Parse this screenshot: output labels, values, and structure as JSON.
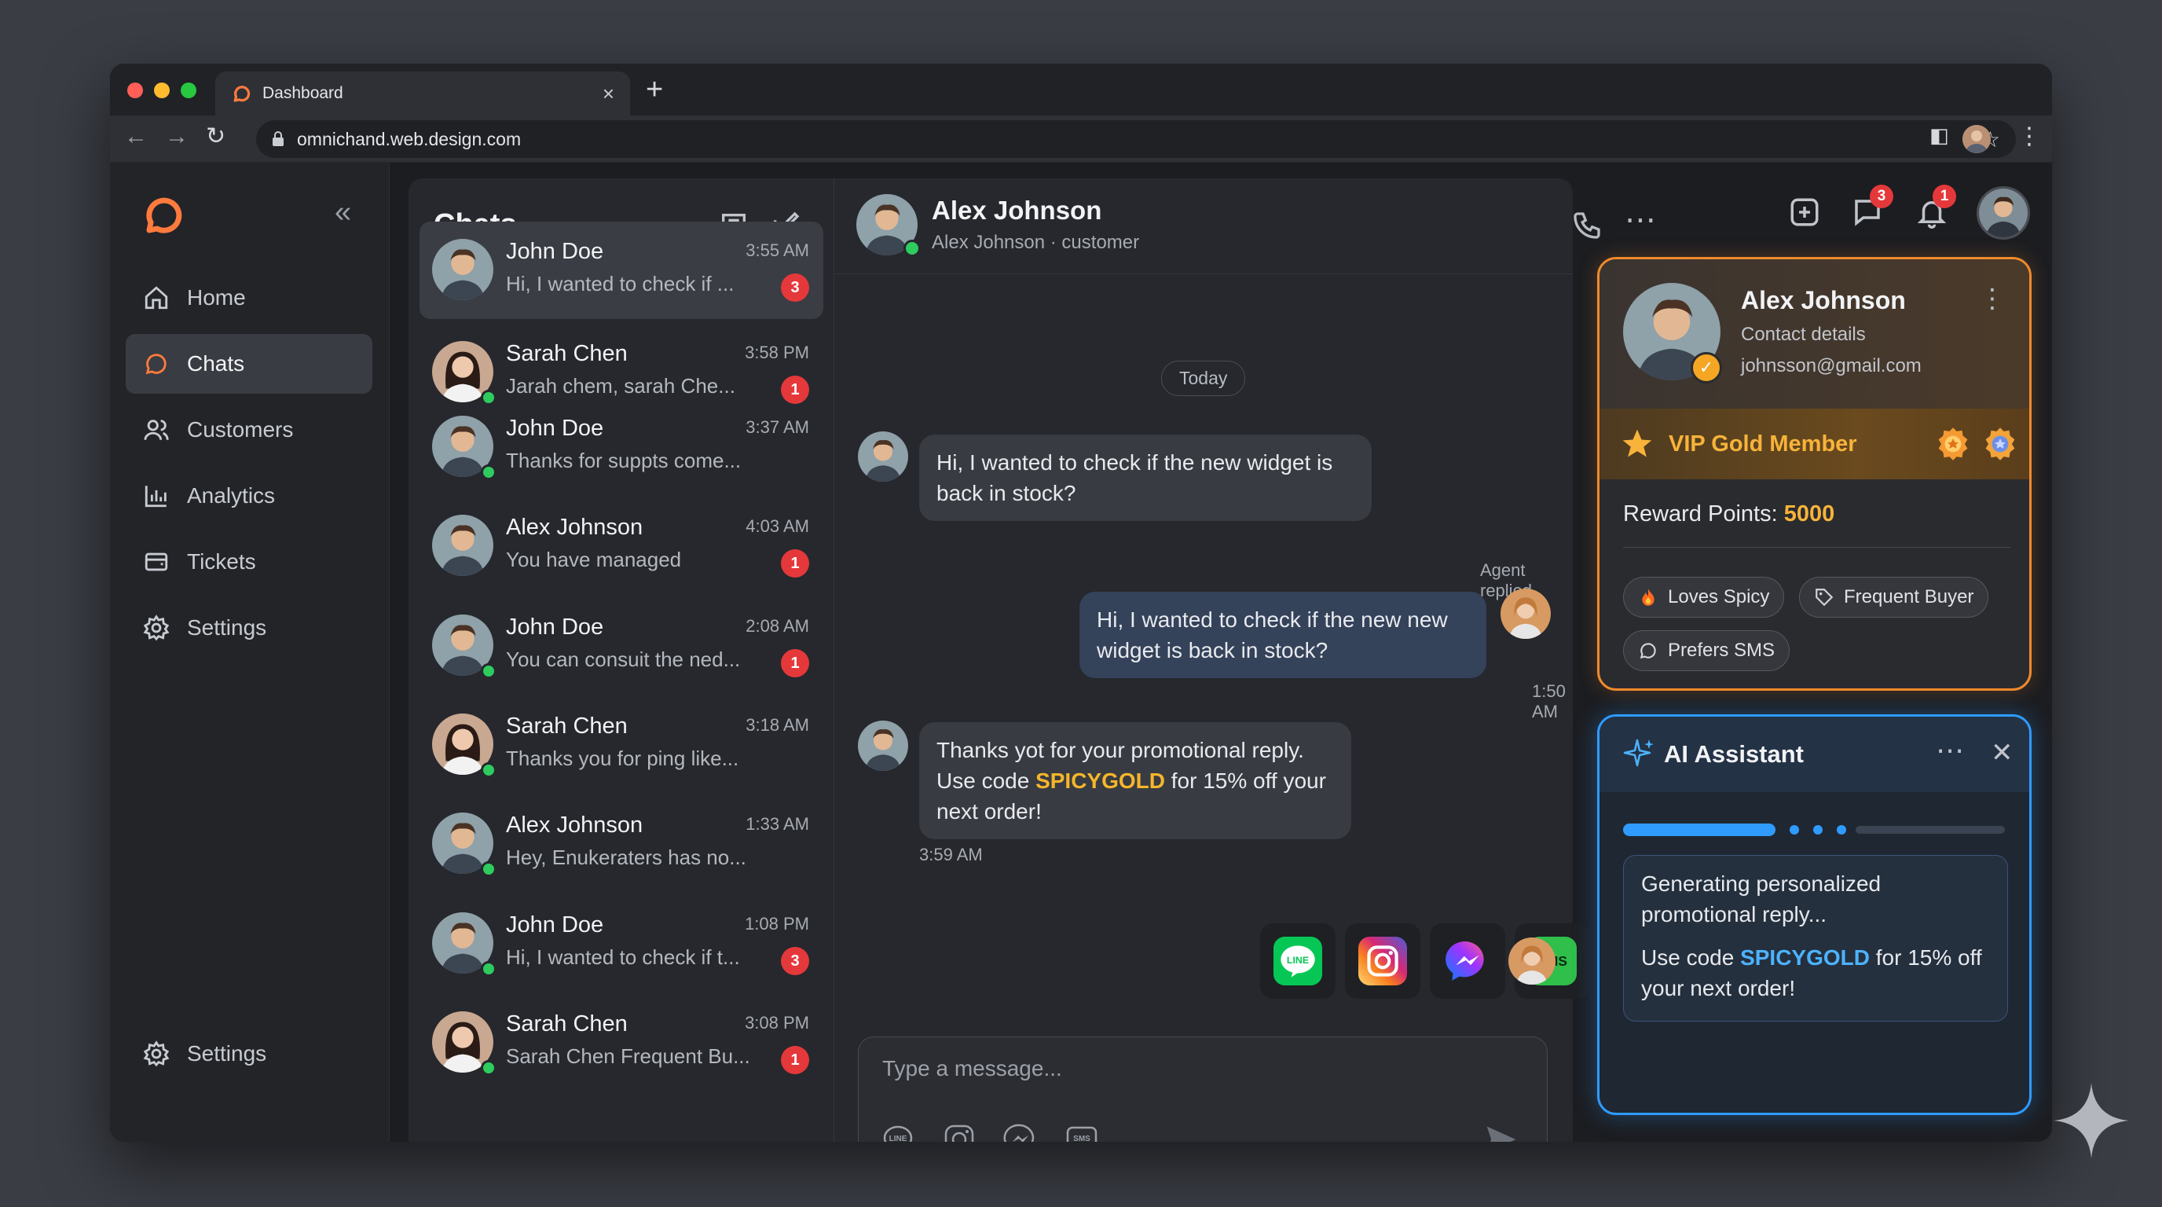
{
  "browser": {
    "tab_title": "Dashboard",
    "url": "omnichand.web.design.com"
  },
  "sidebar": {
    "items": [
      {
        "label": "Home",
        "icon": "home-icon"
      },
      {
        "label": "Chats",
        "icon": "chat-icon",
        "active": true
      },
      {
        "label": "Customers",
        "icon": "users-icon"
      },
      {
        "label": "Analytics",
        "icon": "bar-chart-icon"
      },
      {
        "label": "Tickets",
        "icon": "ticket-icon"
      },
      {
        "label": "Settings",
        "icon": "gear-icon"
      }
    ],
    "footer_label": "Settings"
  },
  "chatlist": {
    "title": "Chats",
    "rows": [
      {
        "name": "John Doe",
        "time": "3:55 AM",
        "preview": "Hi, I wanted to check if ...",
        "badge": "3",
        "online": false
      },
      {
        "name": "Sarah Chen",
        "time": "3:58 PM",
        "preview": "Jarah chem, sarah Che...",
        "badge": "1",
        "online": true
      },
      {
        "name": "John Doe",
        "time": "3:37 AM",
        "preview": "Thanks for suppts come...",
        "badge": "",
        "online": true
      },
      {
        "name": "Alex Johnson",
        "time": "4:03 AM",
        "preview": "You have managed",
        "badge": "1",
        "online": false
      },
      {
        "name": "John Doe",
        "time": "2:08 AM",
        "preview": "You can consuit the ned...",
        "badge": "1",
        "online": true
      },
      {
        "name": "Sarah Chen",
        "time": "3:18 AM",
        "preview": "Thanks you for ping like...",
        "badge": "",
        "online": true
      },
      {
        "name": "Alex Johnson",
        "time": "1:33 AM",
        "preview": "Hey, Enukeraters has no...",
        "badge": "",
        "online": true
      },
      {
        "name": "John Doe",
        "time": "1:08 PM",
        "preview": "Hi, I wanted to check if t...",
        "badge": "3",
        "online": true
      },
      {
        "name": "Sarah Chen",
        "time": "3:08 PM",
        "preview": "Sarah Chen Frequent Bu...",
        "badge": "1",
        "online": true
      }
    ]
  },
  "conversation": {
    "name": "Alex Johnson",
    "subtitle": "Alex Johnson · customer",
    "day": "Today",
    "msg1": "Hi, I wanted to check if the new widget is back in stock?",
    "agent_label": "Agent replied",
    "msg2": "Hi, I wanted to check if the new new widget is back in stock?",
    "msg2_time": "1:50 AM",
    "msg3_pre": "Thanks yot for your promotional reply. Use code ",
    "msg3_code": "SPICYGOLD",
    "msg3_post": " for 15% off your next order!",
    "msg3_time": "3:59 AM",
    "channels": [
      "LINE",
      "Instagram",
      "Messenger",
      "SMS"
    ],
    "compose_placeholder": "Type a message..."
  },
  "header_badges": {
    "messages": "3",
    "notifications": "1"
  },
  "contact": {
    "name": "Alex Johnson",
    "subtitle": "Contact details",
    "email": "johnsson@gmail.com",
    "tier": "VIP Gold Member",
    "reward_label": "Reward Points: ",
    "reward_value": "5000",
    "tags": [
      "Loves Spicy",
      "Frequent Buyer",
      "Prefers SMS"
    ]
  },
  "ai": {
    "title": "AI Assistant",
    "progress": 0.4,
    "status": "Generating personalized promotional reply...",
    "suggest_pre": "Use code ",
    "suggest_code": "SPICYGOLD",
    "suggest_post": " for 15% off your next order!"
  },
  "colors": {
    "accent_orange": "#ff7a3d",
    "gold": "#f7b33a",
    "ai_blue": "#2f9bff",
    "badge_red": "#e5383b",
    "online_green": "#2ecc5e"
  }
}
